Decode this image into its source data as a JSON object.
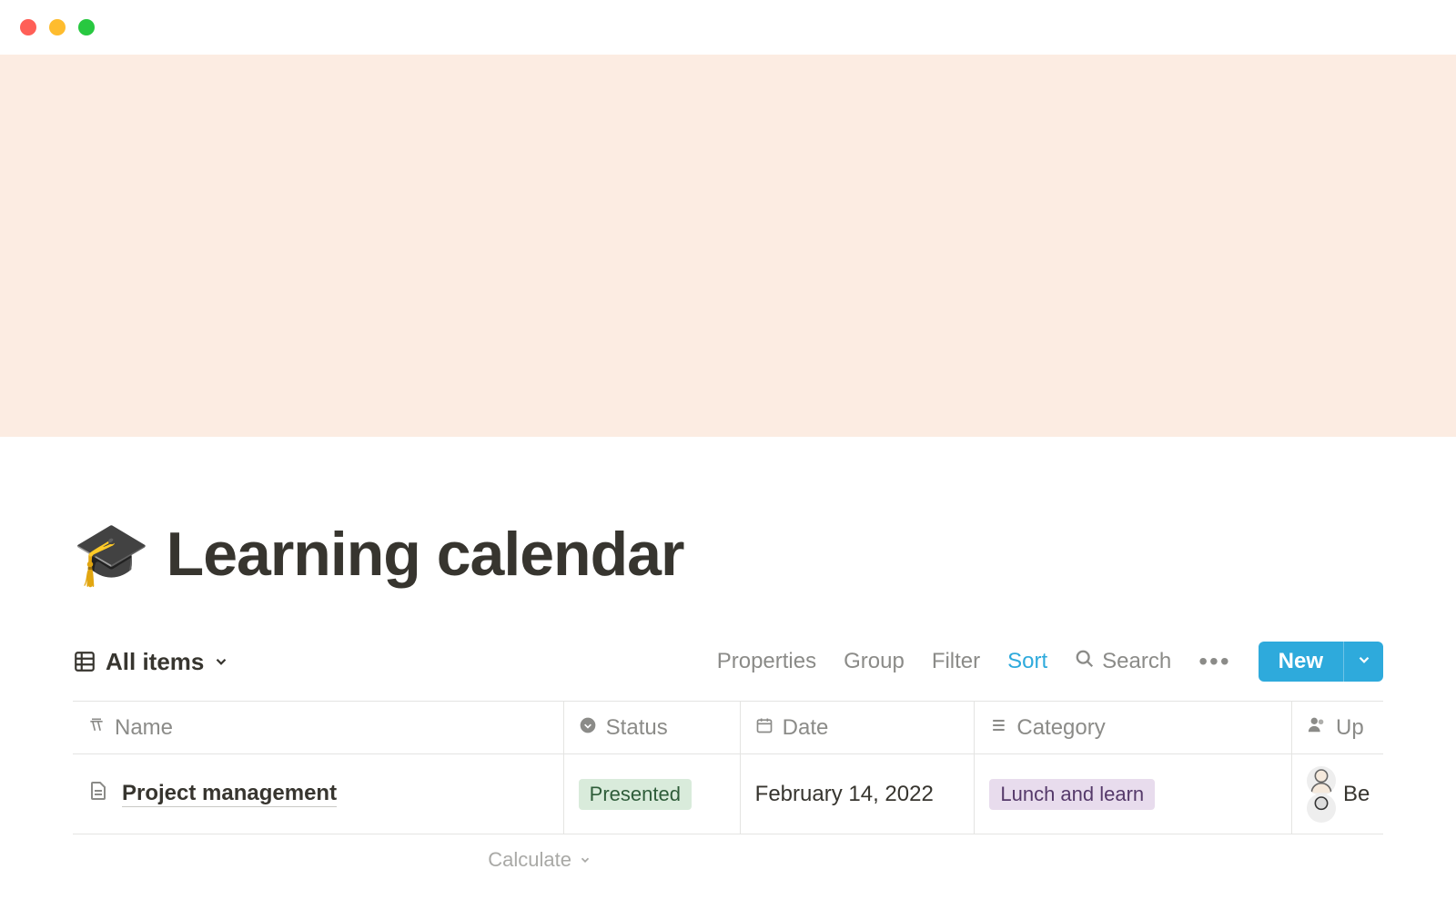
{
  "page": {
    "icon": "🎓",
    "title": "Learning calendar"
  },
  "toolbar": {
    "view_label": "All items",
    "properties": "Properties",
    "group": "Group",
    "filter": "Filter",
    "sort": "Sort",
    "search": "Search",
    "new_label": "New"
  },
  "columns": {
    "name": "Name",
    "status": "Status",
    "date": "Date",
    "category": "Category",
    "people": "Up"
  },
  "rows": [
    {
      "name": "Project management",
      "status": "Presented",
      "date": "February 14, 2022",
      "category": "Lunch and learn",
      "people_text": "Be"
    }
  ],
  "footer": {
    "calculate": "Calculate"
  }
}
